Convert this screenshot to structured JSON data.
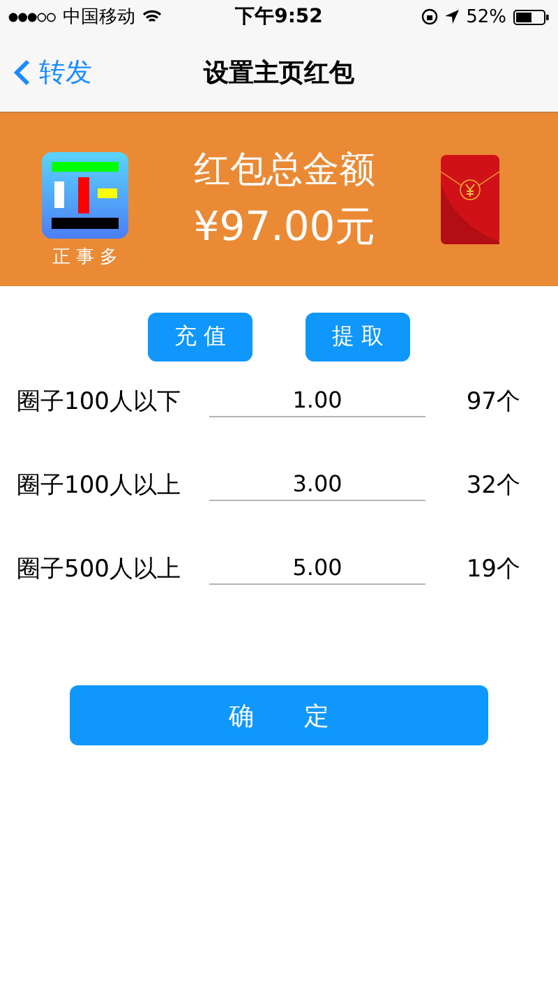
{
  "status_bar": {
    "carrier": "中国移动",
    "time": "下午9:52",
    "battery": "52%"
  },
  "nav": {
    "back": "转发",
    "title": "设置主页红包"
  },
  "banner": {
    "app_name": "正 事 多",
    "title": "红包总金额",
    "amount": "¥97.00元"
  },
  "actions": [
    "充 值",
    "提 取"
  ],
  "rows": [
    {
      "label": "圈子100人以下",
      "value": "1.00",
      "count": "97个"
    },
    {
      "label": "圈子100人以上",
      "value": "3.00",
      "count": "32个"
    },
    {
      "label": "圈子500人以上",
      "value": "5.00",
      "count": "19个"
    }
  ],
  "confirm": "确　　定"
}
